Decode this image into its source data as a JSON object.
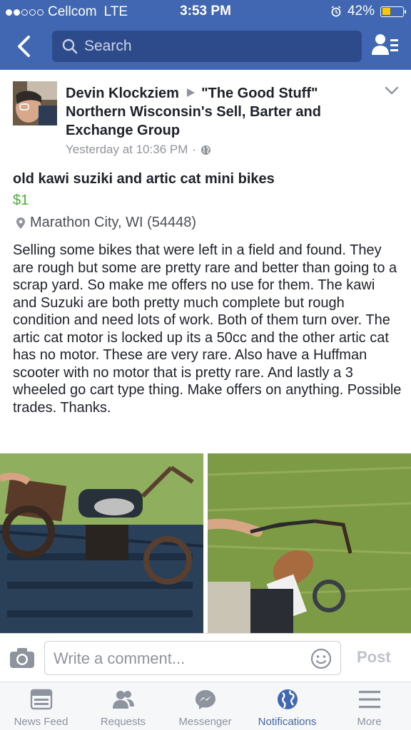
{
  "status_bar": {
    "carrier": "Cellcom",
    "network": "LTE",
    "time": "3:53 PM",
    "battery": "42%",
    "battery_level": 0.42,
    "signal_bars_filled": 2,
    "signal_bars_total": 5
  },
  "nav": {
    "search_placeholder": "Search"
  },
  "post": {
    "author": "Devin Klockziem",
    "group": "\"The Good Stuff\" Northern Wisconsin's Sell, Barter and Exchange Group",
    "timestamp": "Yesterday at 10:36 PM",
    "separator": "·",
    "title": "old kawi suziki and artic cat mini bikes",
    "price": "$1",
    "location": "Marathon City, WI (54448)",
    "body": "Selling some bikes that were left in a field and found. They are rough but some are pretty rare and better than going to a scrap yard. So make me offers no use for them. The kawi and Suzuki are both pretty much complete but rough condition and need lots of work. Both of them turn over. The artic cat motor is locked up its a 50cc and the other artic cat has no motor. These are very rare. Also have a Huffman scooter with no motor that is pretty rare. And lastly a 3 wheeled go cart type thing. Make offers on anything. Possible trades. Thanks."
  },
  "comment": {
    "placeholder": "Write a comment...",
    "post_label": "Post"
  },
  "tabs": [
    {
      "label": "News Feed",
      "icon": "news-feed-icon",
      "active": false
    },
    {
      "label": "Requests",
      "icon": "friend-requests-icon",
      "active": false
    },
    {
      "label": "Messenger",
      "icon": "messenger-icon",
      "active": false
    },
    {
      "label": "Notifications",
      "icon": "globe-icon",
      "active": true
    },
    {
      "label": "More",
      "icon": "menu-icon",
      "active": false
    }
  ],
  "colors": {
    "brand_blue": "#4267b2",
    "price_green": "#42b72a",
    "battery_yellow": "#f5c518",
    "muted_gray": "#90949c"
  }
}
